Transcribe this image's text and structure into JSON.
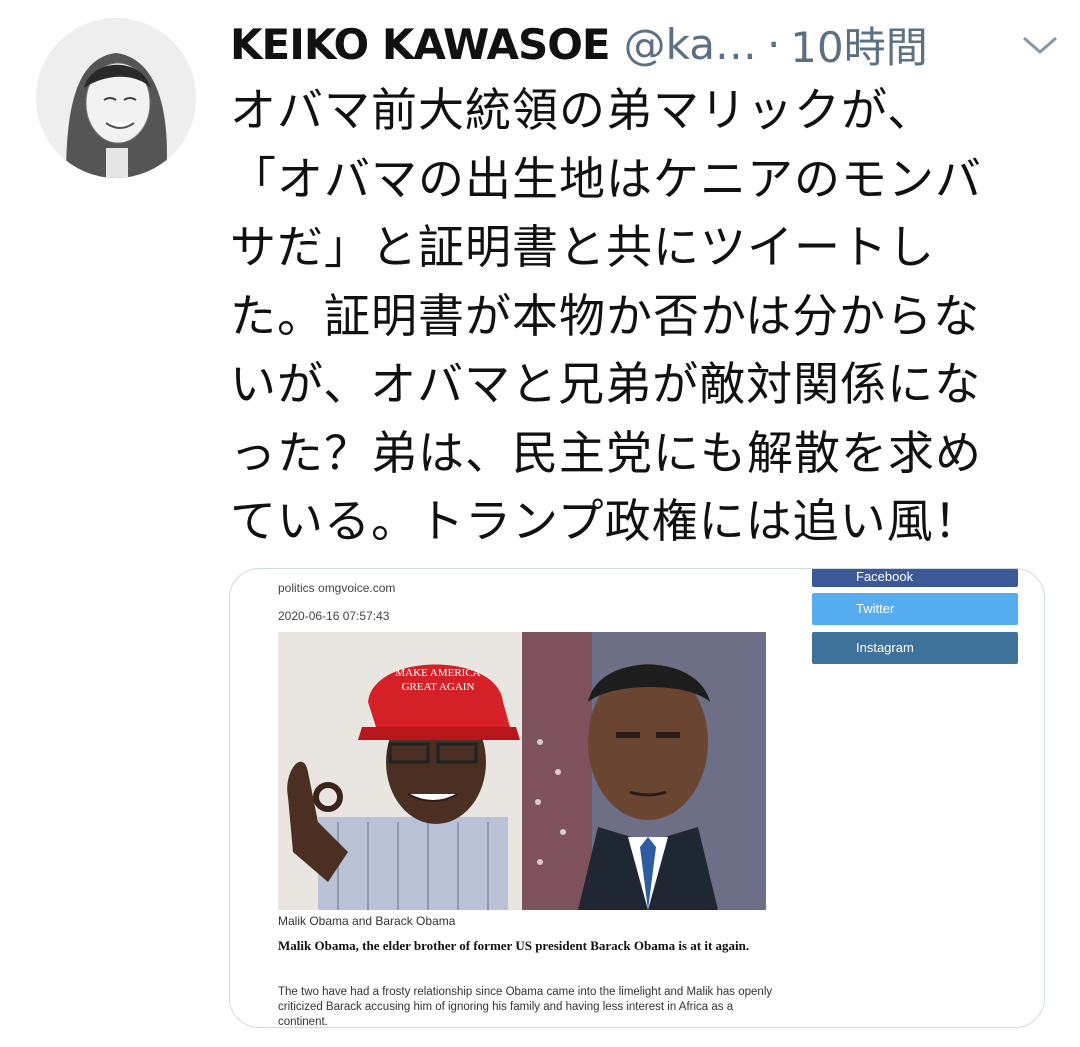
{
  "tweet": {
    "author_name": "KEIKO KAWASOE",
    "author_handle": "@ka…",
    "separator": "·",
    "timestamp": "10時間",
    "text_lines": [
      "オバマ前大統領の弟マリックが、",
      "「オバマの出生地はケニアのモンバ",
      "サだ」と証明書と共にツイートし",
      "た。証明書が本物か否かは分からな",
      "いが、オバマと兄弟が敵対関係にな",
      "った？弟は、民主党にも解散を求め",
      "ている。トランプ政権には追い風！"
    ]
  },
  "card": {
    "site": "politics omgvoice.com",
    "date": "2020-06-16 07:57:43",
    "share": {
      "facebook": "Facebook",
      "twitter": "Twitter",
      "instagram": "Instagram"
    },
    "photo_hat_text": [
      "MAKE AMERICA",
      "GREAT AGAIN"
    ],
    "caption": "Malik Obama and Barack Obama",
    "lead": "Malik Obama, the elder brother of former US president Barack Obama is at it again.",
    "body": "The two have had a frosty relationship since Obama came into the limelight and Malik has openly criticized Barack accusing him of ignoring his family and having less interest in Africa as a continent."
  },
  "icons": {
    "avatar": "avatar",
    "menu": "chevron-down-icon"
  },
  "colors": {
    "text": "#111111",
    "muted": "#5b7083",
    "facebook": "#3b5998",
    "twitter": "#55acee",
    "instagram": "#3f729b"
  }
}
